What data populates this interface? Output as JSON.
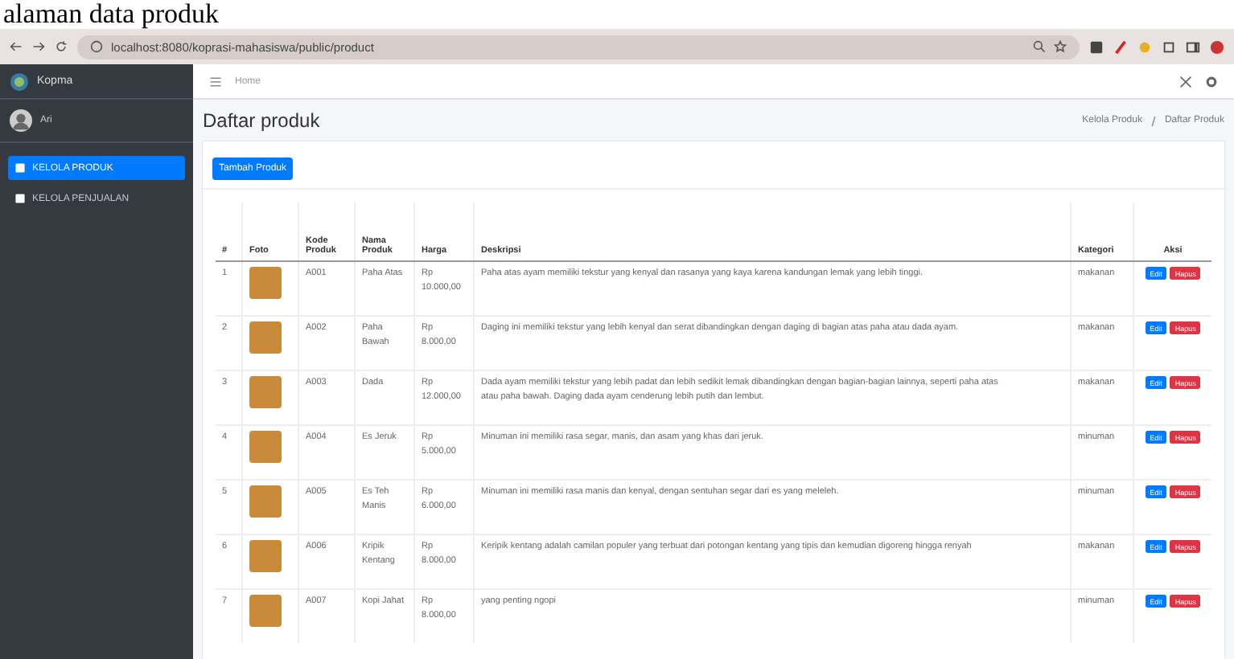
{
  "caption": "alaman data produk",
  "browser": {
    "url": "localhost:8080/koprasi-mahasiswa/public/product"
  },
  "sidebar": {
    "brand": "Kopma",
    "user": "Ari",
    "items": [
      {
        "label": "KELOLA PRODUK",
        "selected": true
      },
      {
        "label": "KELOLA PENJUALAN",
        "selected": false
      }
    ]
  },
  "topbar": {
    "link": "Home"
  },
  "page": {
    "title": "Daftar produk",
    "breadcrumb": [
      "Kelola Produk",
      "Daftar Produk"
    ],
    "add_button": "Tambah Produk"
  },
  "table": {
    "columns": [
      "#",
      "Foto",
      "Kode Produk",
      "Nama Produk",
      "Harga",
      "Deskripsi",
      "Kategori",
      "Aksi"
    ],
    "rows": [
      {
        "no": "1",
        "code": "A001",
        "name": "Paha Atas",
        "price": "Rp 10.000,00",
        "description": "Paha atas ayam memiliki tekstur yang kenyal dan rasanya yang kaya karena kandungan lemak yang lebih tinggi.",
        "category": "makanan",
        "actions": [
          "Edit",
          "Hapus"
        ]
      },
      {
        "no": "2",
        "code": "A002",
        "name": "Paha Bawah",
        "price": "Rp 8.000,00",
        "description": "Daging ini memiliki tekstur yang lebih kenyal dan serat dibandingkan dengan daging di bagian atas paha atau dada ayam.",
        "category": "makanan",
        "actions": [
          "Edit",
          "Hapus"
        ]
      },
      {
        "no": "3",
        "code": "A003",
        "name": "Dada",
        "price": "Rp 12.000,00",
        "description": "Dada ayam memiliki tekstur yang lebih padat dan lebih sedikit lemak dibandingkan dengan bagian-bagian lainnya, seperti paha atas atau paha bawah. Daging dada ayam cenderung lebih putih dan lembut.",
        "category": "makanan",
        "actions": [
          "Edit",
          "Hapus"
        ]
      },
      {
        "no": "4",
        "code": "A004",
        "name": "Es Jeruk",
        "price": "Rp 5.000,00",
        "description": "Minuman ini memiliki rasa segar, manis, dan asam yang khas dari jeruk.",
        "category": "minuman",
        "actions": [
          "Edit",
          "Hapus"
        ]
      },
      {
        "no": "5",
        "code": "A005",
        "name": "Es Teh Manis",
        "price": "Rp 6.000,00",
        "description": "Minuman ini memiliki rasa manis dan kenyal, dengan sentuhan segar dari es yang meleleh.",
        "category": "minuman",
        "actions": [
          "Edit",
          "Hapus"
        ]
      },
      {
        "no": "6",
        "code": "A006",
        "name": "Kripik Kentang",
        "price": "Rp 8.000,00",
        "description": "Keripik kentang adalah camilan populer yang terbuat dari potongan kentang yang tipis dan kemudian digoreng hingga renyah",
        "category": "makanan",
        "actions": [
          "Edit",
          "Hapus"
        ]
      },
      {
        "no": "7",
        "code": "A007",
        "name": "Kopi Jahat",
        "price": "Rp 8.000,00",
        "description": "yang penting ngopi",
        "category": "minuman",
        "actions": [
          "Edit",
          "Hapus"
        ]
      }
    ]
  }
}
